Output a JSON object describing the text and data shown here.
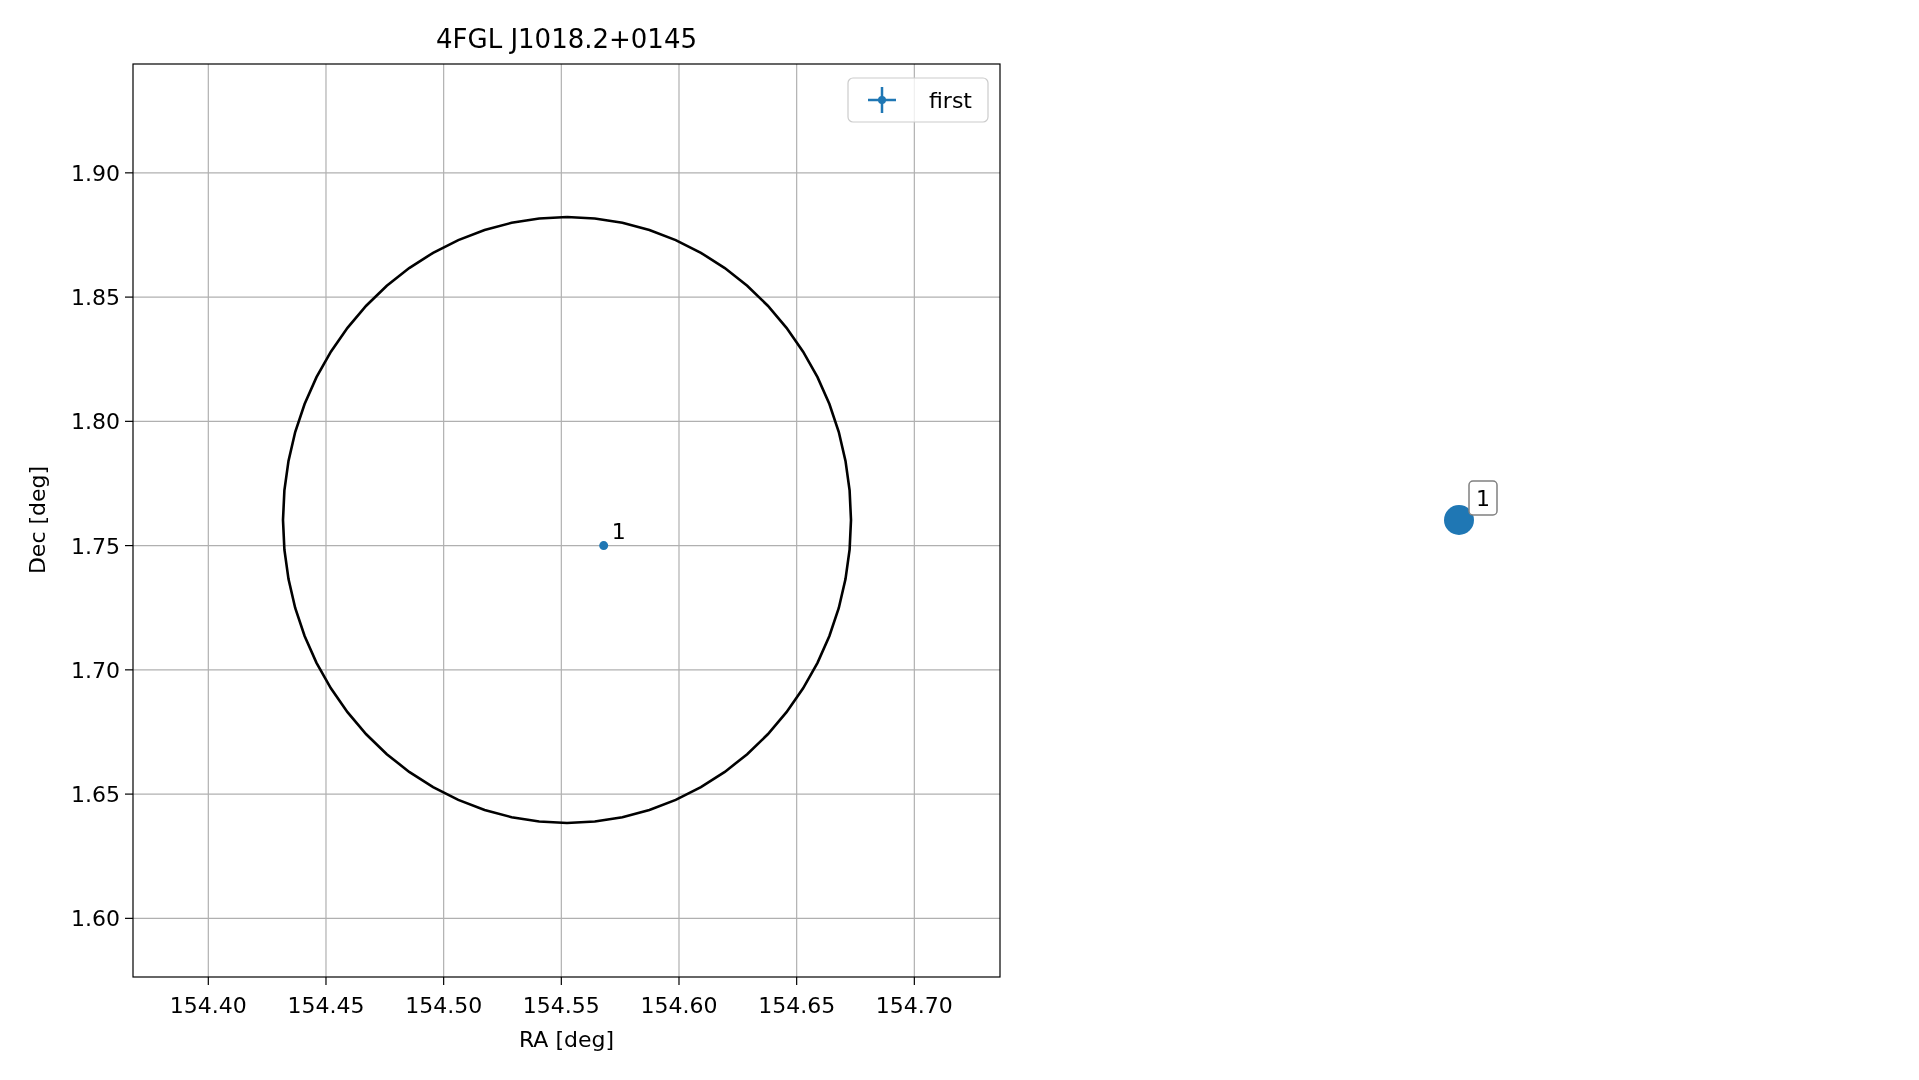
{
  "figure": {
    "chart_data": {
      "type": "scatter",
      "title": "4FGL J1018.2+0145",
      "xlabel": "RA [deg]",
      "ylabel": "Dec [deg]",
      "grid": true,
      "x": [
        154.568
      ],
      "series": [
        {
          "name": "first",
          "color": "#1f77b4",
          "values": [
            1.75
          ]
        }
      ],
      "xlim": [
        154.368,
        154.7364
      ],
      "ylim": [
        1.5764,
        1.9438
      ],
      "xticks": [
        {
          "value": 154.4,
          "label": "154.40"
        },
        {
          "value": 154.45,
          "label": "154.45"
        },
        {
          "value": 154.5,
          "label": "154.50"
        },
        {
          "value": 154.55,
          "label": "154.55"
        },
        {
          "value": 154.6,
          "label": "154.60"
        },
        {
          "value": 154.65,
          "label": "154.65"
        },
        {
          "value": 154.7,
          "label": "154.70"
        }
      ],
      "yticks": [
        {
          "value": 1.6,
          "label": "1.60"
        },
        {
          "value": 1.65,
          "label": "1.65"
        },
        {
          "value": 1.7,
          "label": "1.70"
        },
        {
          "value": 1.75,
          "label": "1.75"
        },
        {
          "value": 1.8,
          "label": "1.80"
        },
        {
          "value": 1.85,
          "label": "1.85"
        },
        {
          "value": 1.9,
          "label": "1.90"
        }
      ],
      "annotations": [
        {
          "text": "1",
          "x": 154.568,
          "y": 1.75
        }
      ]
    }
  },
  "outer_marker": {
    "label": "1",
    "color": "#1f77b4"
  }
}
